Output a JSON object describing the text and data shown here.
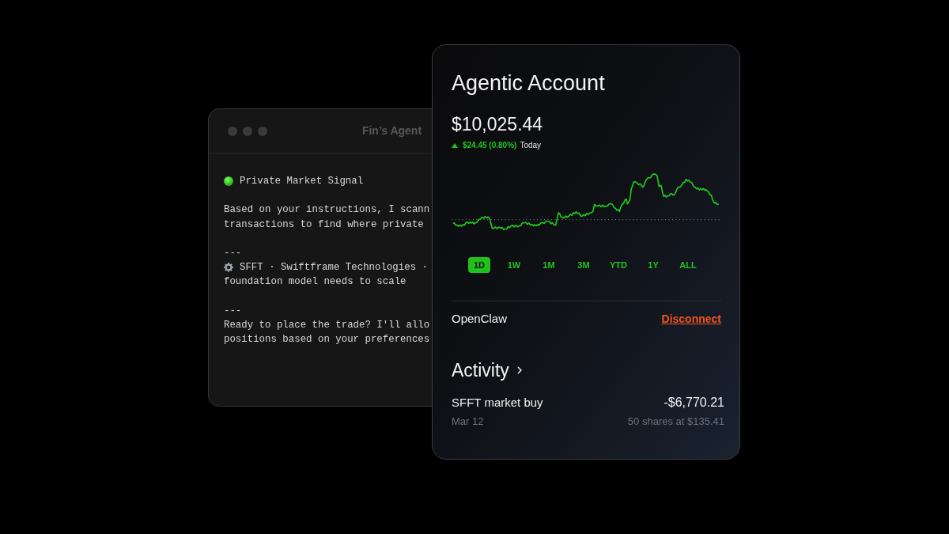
{
  "agent_window": {
    "title": "Fin’s Agent",
    "blocks": [
      {
        "kind": "heading",
        "text": "Private Market Signal"
      },
      {
        "kind": "paragraph",
        "text": "Based on your instructions, I scann\ntransactions to find where private"
      },
      {
        "kind": "divider",
        "text": "---"
      },
      {
        "kind": "ticker",
        "lines": [
          "SFFT · Swiftframe Technologies ·",
          "foundation model needs to scale"
        ]
      },
      {
        "kind": "divider",
        "text": "---"
      },
      {
        "kind": "paragraph",
        "text": "Ready to place the trade? I'll allo\npositions based on your preferences"
      }
    ]
  },
  "account_card": {
    "title": "Agentic Account",
    "balance": "$10,025.44",
    "change": {
      "up": true,
      "amount": "$24.45 (0.80%)",
      "period": "Today"
    },
    "ranges": [
      {
        "label": "1D",
        "selected": true
      },
      {
        "label": "1W",
        "selected": false
      },
      {
        "label": "1M",
        "selected": false
      },
      {
        "label": "3M",
        "selected": false
      },
      {
        "label": "YTD",
        "selected": false
      },
      {
        "label": "1Y",
        "selected": false
      },
      {
        "label": "ALL",
        "selected": false
      }
    ],
    "connection": {
      "name": "OpenClaw",
      "action": "Disconnect"
    },
    "activity": {
      "title": "Activity",
      "items": [
        {
          "title": "SFFT market buy",
          "amount": "-$6,770.21",
          "date": "Mar 12",
          "detail": "50 shares at $135.41"
        }
      ]
    }
  }
}
